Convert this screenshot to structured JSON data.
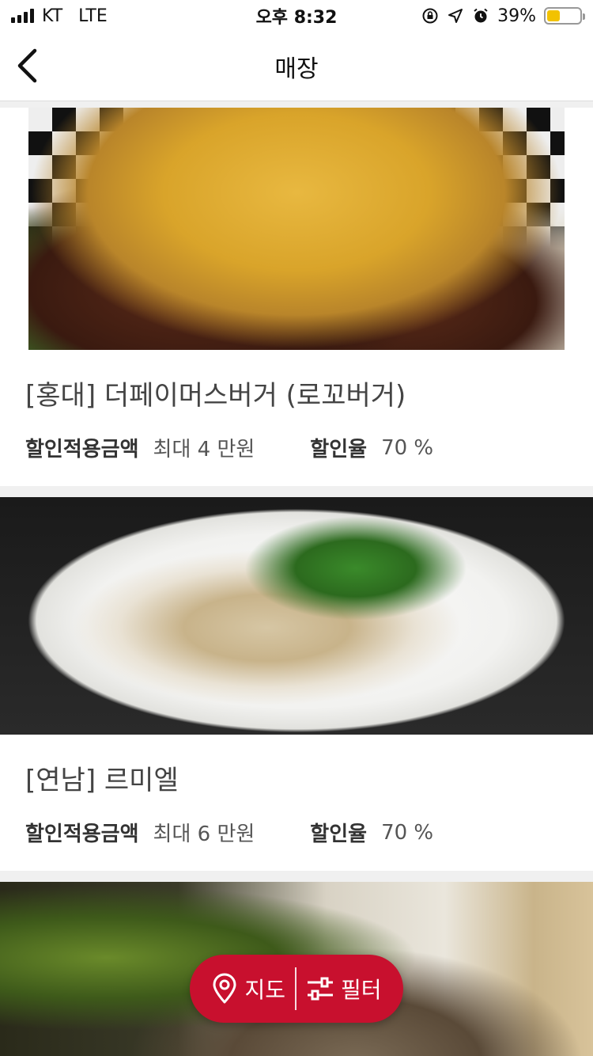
{
  "status_bar": {
    "carrier": "KT",
    "network": "LTE",
    "time": "오후 8:32",
    "battery_text": "39%",
    "battery_level": 0.39,
    "icons": [
      "signal-icon",
      "rotation-lock-icon",
      "location-arrow-icon",
      "alarm-icon",
      "battery-icon"
    ]
  },
  "nav": {
    "title": "매장",
    "back_icon": "chevron-left-icon"
  },
  "stores": [
    {
      "title": "[홍대] 더페이머스버거 (로꼬버거)",
      "discount_amount_label": "할인적용금액",
      "discount_amount_value": "최대 4 만원",
      "discount_rate_label": "할인율",
      "discount_rate_value": "70 %",
      "image": "burger-photo"
    },
    {
      "title": "[연남] 르미엘",
      "discount_amount_label": "할인적용금액",
      "discount_amount_value": "최대 6 만원",
      "discount_rate_label": "할인율",
      "discount_rate_value": "70 %",
      "image": "pasta-photo"
    },
    {
      "image": "restaurant-interior-photo"
    }
  ],
  "floating_button": {
    "map_label": "지도",
    "map_icon": "map-pin-icon",
    "filter_label": "필터",
    "filter_icon": "sliders-icon",
    "color": "#c8102e"
  }
}
